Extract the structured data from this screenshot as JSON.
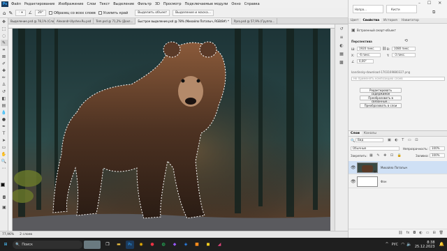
{
  "menu": {
    "logo": "Ps",
    "items": [
      "Файл",
      "Редактирование",
      "Изображение",
      "Слои",
      "Текст",
      "Выделение",
      "Фильтр",
      "3D",
      "Просмотр",
      "Подключаемые модули",
      "Окно",
      "Справка"
    ]
  },
  "options": {
    "angle": "29°",
    "sample_all_layers": "Образец со всех слоев",
    "enhance_edge": "Усилить край",
    "select_subject": "Выделить объект",
    "select_and_mask": "Выделение и маска..."
  },
  "mini_panel": {
    "item1": "Напра...",
    "item2": "Кисти"
  },
  "doc_tabs": [
    {
      "label": "Выделение.psd @ 78,1% (Слой...",
      "active": false
    },
    {
      "label": "Alexandr-Ulyshev.Ru.psd",
      "active": false
    },
    {
      "label": "Tem.psd @ 71,2% (Дохл...",
      "active": false
    },
    {
      "label": "Быстрое выделение.psd @ 78% (Михайло Потапыч, RGB/8#) *",
      "active": true
    },
    {
      "label": "Ppro.psd @ 57,9% (Группа...",
      "active": false
    }
  ],
  "status": {
    "zoom": "77,96%",
    "info": "2 слоев"
  },
  "properties": {
    "tabs": [
      "Цвет",
      "Свойства",
      "История",
      "Навигатор"
    ],
    "embedded_label": "Встроенный смарт-объект",
    "transform_label": "Перспектива",
    "w_label": "Ш:",
    "w_value": "1920 пикс.",
    "h_label": "В:",
    "h_value": "1080 пикс.",
    "x_label": "X:",
    "x_value": "-6 пикс.",
    "y_label": "Y:",
    "y_value": "-3 пикс.",
    "angle_value": "0,00°",
    "filename": "kandinsky-download-1703169880327.png",
    "comp_placeholder": "Не применять композицию слоев",
    "btn_edit": "Редактировать содержимое",
    "btn_convert_linked": "Преобразовать в связанные...",
    "btn_convert_layers": "Преобразовать в слои"
  },
  "layers": {
    "tabs": [
      "Слои",
      "Каналы"
    ],
    "search": "Вид",
    "blend_mode": "Обычные",
    "opacity_label": "Непрозрачность:",
    "opacity_value": "100%",
    "lock_label": "Закрепить:",
    "fill_label": "Заливка:",
    "fill_value": "100%",
    "items": [
      {
        "name": "Михайло Потапыч",
        "selected": true
      },
      {
        "name": "Фон",
        "selected": false
      }
    ]
  },
  "taskbar": {
    "search": "Поиск",
    "lang": "РУС",
    "time": "8:38",
    "date": "25.12.2023"
  },
  "colors": {
    "accent": "#31a8ff",
    "panel_bg": "#f2f2f2",
    "selected_layer": "#cfe0f5"
  }
}
